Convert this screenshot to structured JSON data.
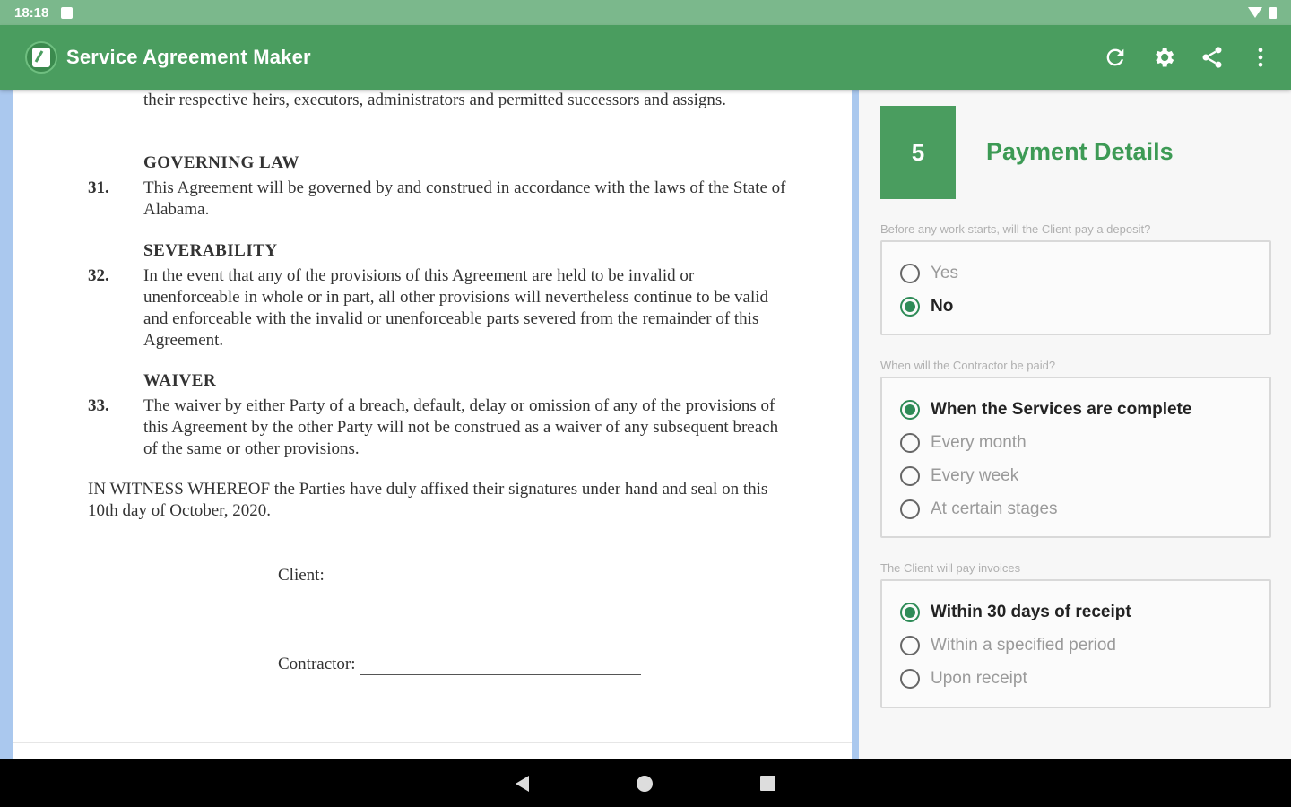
{
  "status_bar": {
    "time": "18:18"
  },
  "app_bar": {
    "title": "Service Agreement Maker",
    "actions": [
      "refresh-icon",
      "settings-icon",
      "share-icon",
      "more-vert-icon"
    ]
  },
  "document": {
    "lead_text": "their respective heirs, executors, administrators and permitted successors and assigns.",
    "sections": [
      {
        "heading": "GOVERNING LAW",
        "number": "31.",
        "text": "This Agreement will be governed by and construed in accordance with the laws of the State of Alabama."
      },
      {
        "heading": "SEVERABILITY",
        "number": "32.",
        "text": "In the event that any of the provisions of this Agreement are held to be invalid or unenforceable in whole or in part, all other provisions will nevertheless continue to be valid and enforceable with the invalid or unenforceable parts severed from the remainder of this Agreement."
      },
      {
        "heading": "WAIVER",
        "number": "33.",
        "text": "The waiver by either Party of a breach, default, delay or omission of any of the provisions of this Agreement by the other Party will not be construed as a waiver of any subsequent breach of the same or other provisions."
      }
    ],
    "witness": "IN WITNESS WHEREOF the Parties have duly affixed their signatures under hand and seal on this 10th day of October, 2020.",
    "signatures": {
      "client_label": "Client:",
      "contractor_label": "Contractor:"
    }
  },
  "form": {
    "step_number": "5",
    "step_title": "Payment Details",
    "questions": [
      {
        "label": "Before any work starts, will the Client pay a deposit?",
        "options": [
          "Yes",
          "No"
        ],
        "selected": "No"
      },
      {
        "label": "When will the Contractor be paid?",
        "options": [
          "When the Services are complete",
          "Every month",
          "Every week",
          "At certain stages"
        ],
        "selected": "When the Services are complete"
      },
      {
        "label": "The Client will pay invoices",
        "options": [
          "Within 30 days of receipt",
          "Within a specified period",
          "Upon receipt"
        ],
        "selected": "Within 30 days of receipt"
      }
    ]
  },
  "colors": {
    "primary": "#4a9d5f",
    "status_bar": "#7bb88c",
    "accent": "#2e8b57",
    "doc_border": "#aac8ee"
  }
}
